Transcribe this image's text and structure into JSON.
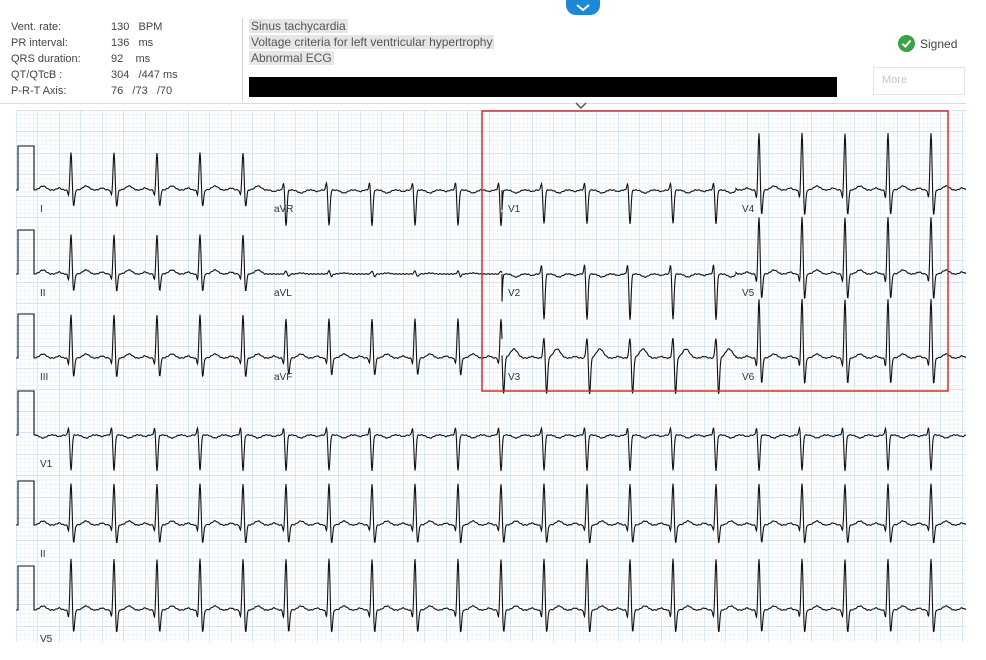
{
  "measurements": [
    {
      "label": "Vent. rate:",
      "value": "130   BPM"
    },
    {
      "label": "PR interval:",
      "value": "136   ms"
    },
    {
      "label": "QRS duration:",
      "value": "92    ms"
    },
    {
      "label": "QT/QTcB :",
      "value": "304   /447 ms"
    },
    {
      "label": "P-R-T Axis:",
      "value": "76   /73   /70"
    }
  ],
  "interpretation": [
    "Sinus tachycardia",
    "Voltage criteria for left ventricular hypertrophy",
    "Abnormal ECG"
  ],
  "status": {
    "label": "Signed",
    "icon": "check-circle-icon",
    "color": "#3aa344"
  },
  "more_button": {
    "label": "More"
  },
  "colors": {
    "grid_minor": "#d4e5f4",
    "grid_major": "#aecde9",
    "trace": "#111111",
    "highlight": "#d32f2f",
    "tab": "#1e88d8"
  },
  "leads": {
    "row1": [
      "I",
      "aVR",
      "V1",
      "V4"
    ],
    "row2": [
      "II",
      "aVL",
      "V2",
      "V5"
    ],
    "row3": [
      "III",
      "aVF",
      "V3",
      "V6"
    ],
    "rhythm": [
      "V1",
      "II",
      "V5"
    ]
  }
}
